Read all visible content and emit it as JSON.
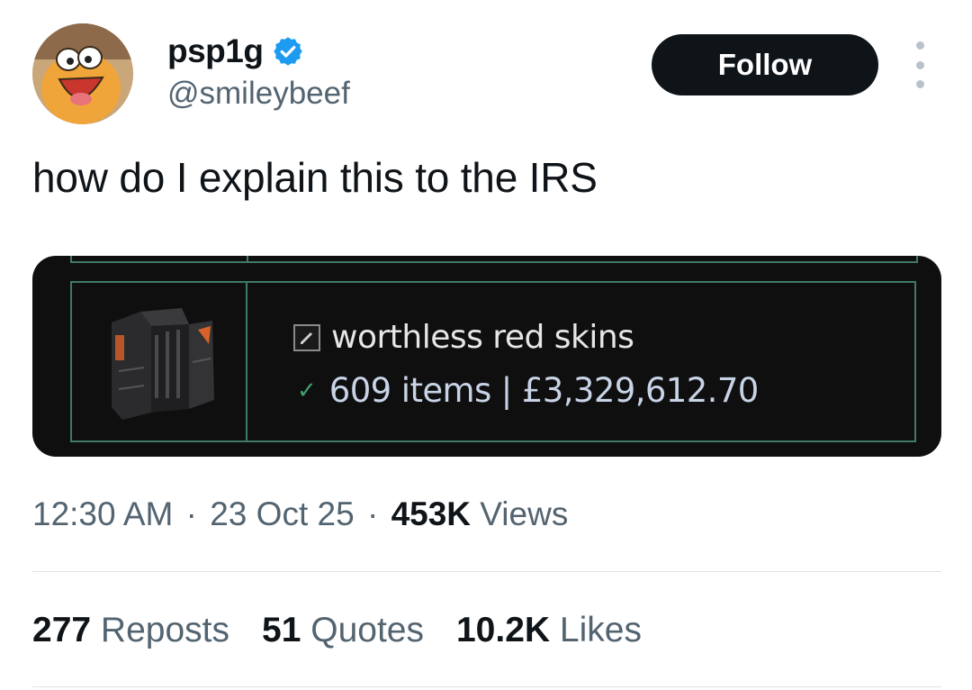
{
  "author": {
    "display_name": "psp1g",
    "handle": "@smileybeef",
    "verified": true,
    "verified_color": "#1d9bf0"
  },
  "actions": {
    "follow_label": "Follow",
    "more_icon": "more-vertical-icon"
  },
  "tweet": {
    "text": "how do I explain this to the IRS"
  },
  "media": {
    "item_name": "worthless red skins",
    "item_status": "609 items | £3,329,612.70",
    "accent_green": "#3f7a62",
    "icon_edit": "pencil-icon",
    "icon_check": "checkmark-icon",
    "icon_item": "crate-icon"
  },
  "meta": {
    "time": "12:30 AM",
    "date": "23 Oct 25",
    "views_count": "453K",
    "views_label": "Views"
  },
  "stats": {
    "reposts_count": "277",
    "reposts_label": "Reposts",
    "quotes_count": "51",
    "quotes_label": "Quotes",
    "likes_count": "10.2K",
    "likes_label": "Likes"
  }
}
